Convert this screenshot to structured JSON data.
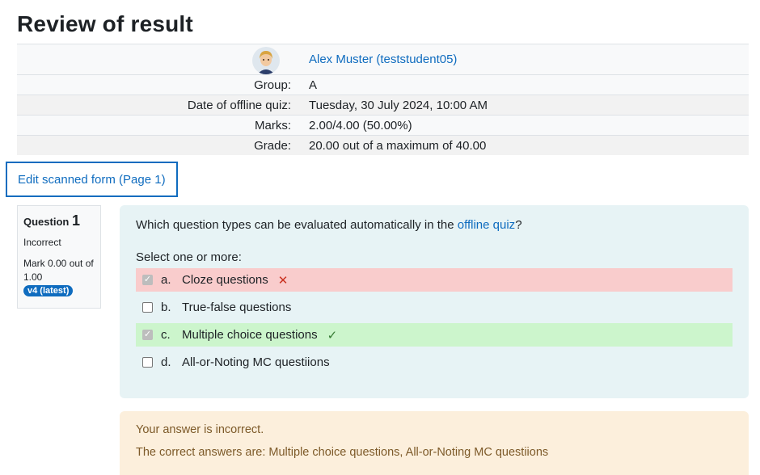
{
  "page": {
    "title": "Review of result"
  },
  "summary": {
    "user_name": "Alex Muster (teststudent05)",
    "rows": [
      {
        "label": "Group:",
        "value": "A"
      },
      {
        "label": "Date of offline quiz:",
        "value": "Tuesday, 30 July 2024, 10:00 AM"
      },
      {
        "label": "Marks:",
        "value": "2.00/4.00 (50.00%)"
      },
      {
        "label": "Grade:",
        "value": "20.00 out of a maximum of 40.00"
      }
    ]
  },
  "edit_link": "Edit scanned form (Page 1)",
  "question_info": {
    "label": "Question",
    "number": "1",
    "state": "Incorrect",
    "mark": "Mark 0.00 out of 1.00",
    "version": "v4 (latest)"
  },
  "question": {
    "text_before": "Which question types can be evaluated automatically in the ",
    "text_link": "offline quiz",
    "text_after": "?",
    "prompt": "Select one or more:",
    "answers": [
      {
        "letter": "a.",
        "text": "Cloze questions",
        "checked": true,
        "status": "incorrect",
        "icon": "cross-icon"
      },
      {
        "letter": "b.",
        "text": "True-false questions",
        "checked": false,
        "status": "none",
        "icon": ""
      },
      {
        "letter": "c.",
        "text": "Multiple choice questions",
        "checked": true,
        "status": "correct",
        "icon": "check-icon"
      },
      {
        "letter": "d.",
        "text": "All-or-Noting MC questiions",
        "checked": false,
        "status": "none",
        "icon": ""
      }
    ]
  },
  "feedback": {
    "line1": "Your answer is incorrect.",
    "line2": "The correct answers are: Multiple choice questions, All-or-Noting MC questiions"
  },
  "colors": {
    "link": "#0f6cbf",
    "incorrect_bg": "#f9cccc",
    "correct_bg": "#ccf5cc",
    "formulation_bg": "#e7f3f5",
    "feedback_bg": "#fcefdc"
  }
}
